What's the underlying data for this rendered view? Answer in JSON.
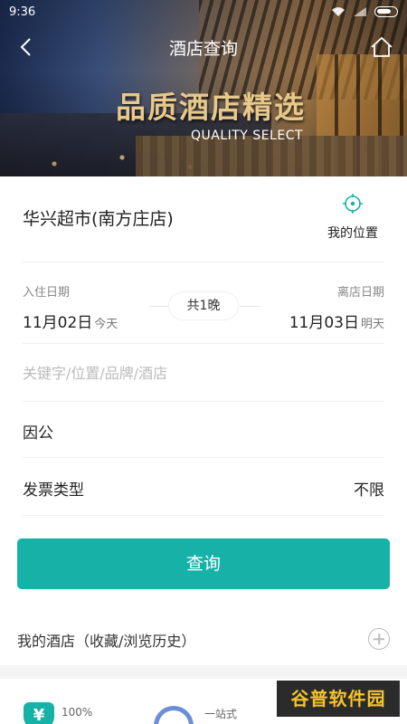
{
  "status_bar": {
    "time": "9:36"
  },
  "header": {
    "title": "酒店查询"
  },
  "banner": {
    "slogan_cn": "品质酒店精选",
    "slogan_en": "QUALITY SELECT"
  },
  "location": {
    "name": "华兴超市(南方庄店)",
    "my_location_label": "我的位置"
  },
  "dates": {
    "checkin_label": "入住日期",
    "checkout_label": "离店日期",
    "checkin_date": "11月02日",
    "checkin_hint": "今天",
    "checkout_date": "11月03日",
    "checkout_hint": "明天",
    "nights": "共1晚"
  },
  "keyword": {
    "placeholder": "关键字/位置/品牌/酒店",
    "value": ""
  },
  "purpose": {
    "value": "因公"
  },
  "invoice": {
    "label": "发票类型",
    "value": "不限"
  },
  "search_button": {
    "label": "查询"
  },
  "my_hotel": {
    "label": "我的酒店（收藏/浏览历史）"
  },
  "features": [
    {
      "icon": "yen-shield-icon",
      "text": "100%"
    },
    {
      "icon": "customer-service-icon",
      "text": "一站式"
    }
  ],
  "watermark": {
    "text": "谷普软件园"
  },
  "colors": {
    "accent": "#16b2a7",
    "gold": "#e8c98b"
  }
}
